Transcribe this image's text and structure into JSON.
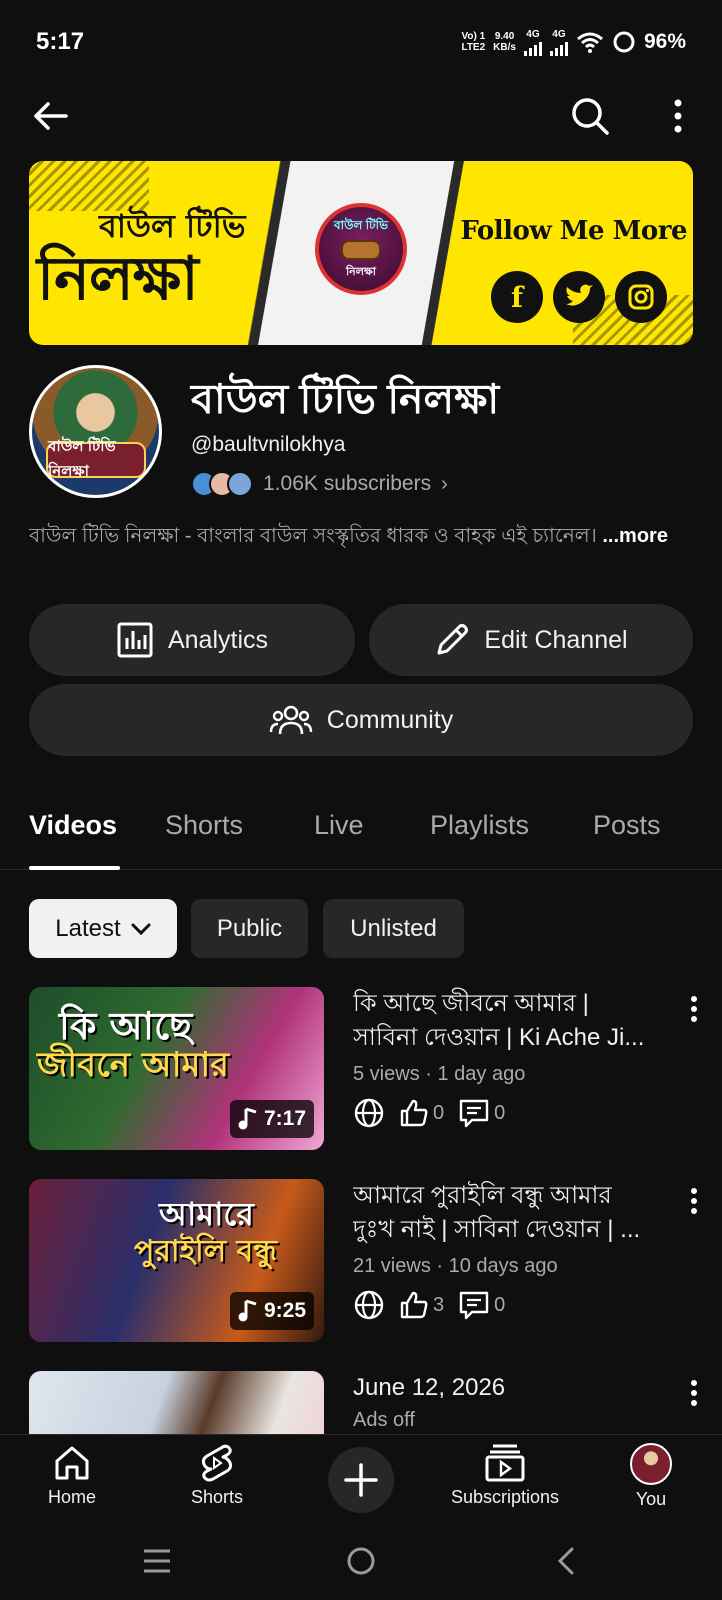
{
  "status": {
    "time": "5:17",
    "volte_1": "Vo) 1",
    "volte_2": "LTE2",
    "speed_value": "9.40",
    "speed_unit": "KB/s",
    "net1": "4G",
    "net2": "4G",
    "battery": "96%"
  },
  "topbar": {
    "back_icon": "arrow-left-icon",
    "search_icon": "search-icon",
    "menu_icon": "more-vert-icon"
  },
  "banner": {
    "title_small": "বাউল টিভি",
    "title_big": "নিলক্ষা",
    "logo_top": "বাউল টিভি",
    "logo_bottom": "নিলক্ষা",
    "follow_text": "Follow Me More",
    "social": [
      "f",
      "t",
      "ig"
    ]
  },
  "channel": {
    "avatar_badge": "বাউল টিভি নিলক্ষা",
    "name": "বাউল টিভি নিলক্ষা",
    "handle": "@baultvnilokhya",
    "subscribers": "1.06K subscribers",
    "description": "বাউল টিভি নিলক্ষা - বাংলার বাউল সংস্কৃতির ধারক ও বাহক এই চ্যানেল।",
    "more_label": "...more"
  },
  "actions": {
    "analytics": "Analytics",
    "edit_channel": "Edit Channel",
    "community": "Community"
  },
  "tabs": [
    "Videos",
    "Shorts",
    "Live",
    "Playlists",
    "Posts"
  ],
  "chips": [
    "Latest",
    "Public",
    "Unlisted"
  ],
  "videos": [
    {
      "thumb_line1": "কি আছে",
      "thumb_line2": "জীবনে আমার",
      "duration": "7:17",
      "title_line1": "কি আছে জীবনে আমার |",
      "title_line2": "সাবিনা দেওয়ান | Ki Ache Ji...",
      "meta": "5 views · 1 day ago",
      "likes": "0",
      "comments": "0"
    },
    {
      "thumb_line1": "আমারে",
      "thumb_line2": "পুরাইলি বন্ধু",
      "duration": "9:25",
      "title_line1": "আমারে পুরাইলি বন্ধু আমার",
      "title_line2": "দুঃখ নাই | সাবিনা দেওয়ান | ...",
      "meta": "21 views · 10 days ago",
      "likes": "3",
      "comments": "0"
    },
    {
      "title_line1": "June 12, 2026",
      "meta": "Ads off"
    }
  ],
  "bottom_nav": {
    "home": "Home",
    "shorts": "Shorts",
    "subscriptions": "Subscriptions",
    "you": "You"
  },
  "colors": {
    "background": "#0f0f0f",
    "surface": "#272727",
    "text": "#f1f1f1",
    "secondary": "#aaaaaa",
    "banner_yellow": "#ffe600"
  }
}
